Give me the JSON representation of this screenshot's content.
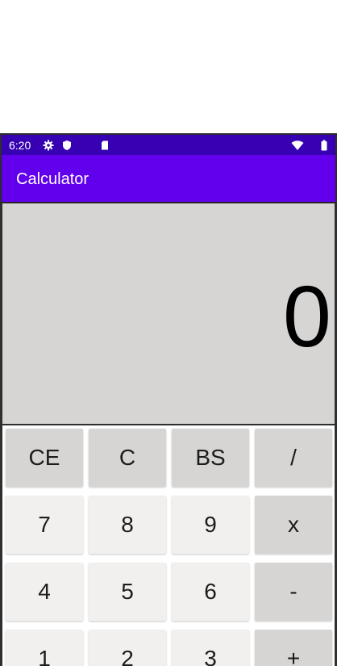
{
  "status_bar": {
    "time": "6:20",
    "icons": [
      "gear-icon",
      "shield-icon",
      "sd-card-icon",
      "wifi-icon",
      "battery-icon"
    ]
  },
  "app_bar": {
    "title": "Calculator"
  },
  "display": {
    "value": "0"
  },
  "keypad": {
    "rows": [
      [
        "CE",
        "C",
        "BS",
        "/"
      ],
      [
        "7",
        "8",
        "9",
        "x"
      ],
      [
        "4",
        "5",
        "6",
        "-"
      ],
      [
        "1",
        "2",
        "3",
        "+"
      ]
    ]
  },
  "colors": {
    "status_bar": "#3700b3",
    "app_bar": "#6200ee",
    "display_bg": "#d6d5d4",
    "number_key": "#f2f0ef",
    "operator_key": "#d6d5d4"
  }
}
